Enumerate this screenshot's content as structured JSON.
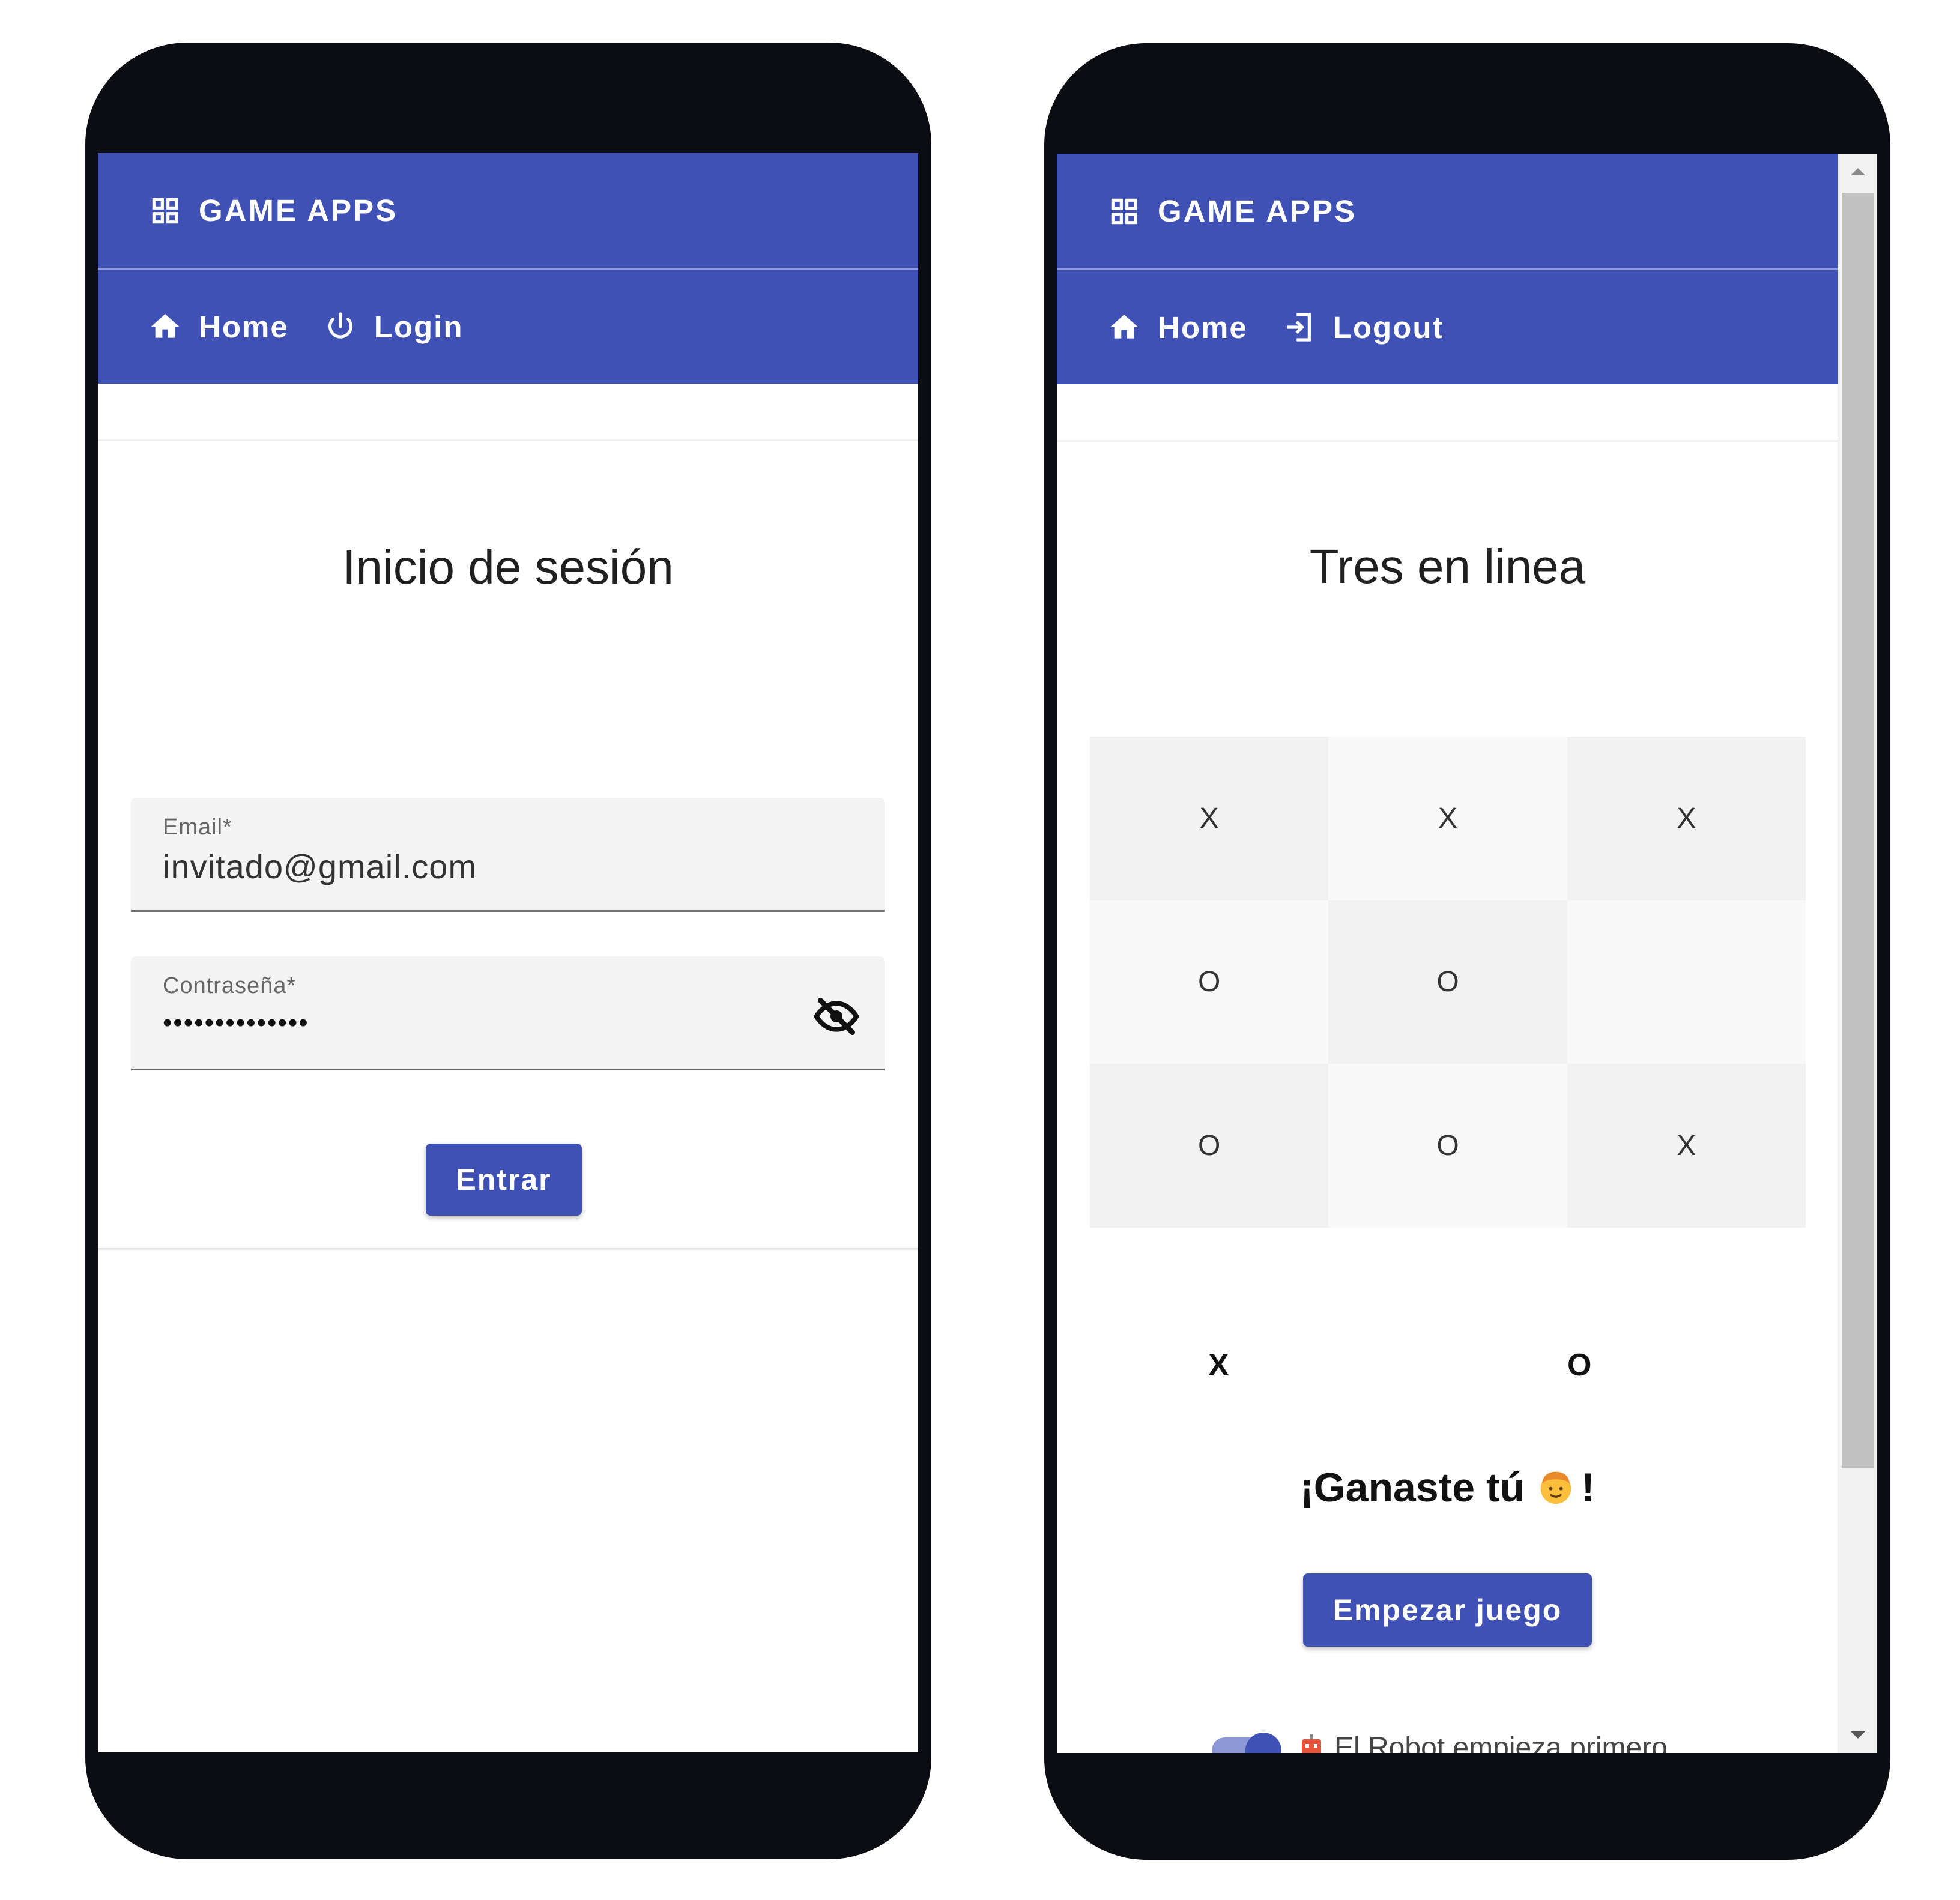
{
  "left_screen": {
    "app_bar": {
      "title": "GAME APPS",
      "icon": "grid-icon"
    },
    "nav": [
      {
        "label": "Home",
        "icon": "home-icon"
      },
      {
        "label": "Login",
        "icon": "power-icon"
      }
    ],
    "login": {
      "title": "Inicio de sesión",
      "email": {
        "label": "Email*",
        "value": "invitado@gmail.com"
      },
      "password": {
        "label": "Contraseña*",
        "value": "••••••••••••••",
        "toggle_icon": "eye-off-icon"
      },
      "submit_label": "Entrar"
    }
  },
  "right_screen": {
    "app_bar": {
      "title": "GAME APPS",
      "icon": "grid-icon"
    },
    "nav": [
      {
        "label": "Home",
        "icon": "home-icon"
      },
      {
        "label": "Logout",
        "icon": "logout-icon"
      }
    ],
    "game": {
      "title": "Tres en linea",
      "board": [
        [
          "X",
          "X",
          "X"
        ],
        [
          "O",
          "O",
          ""
        ],
        [
          "O",
          "O",
          "X"
        ]
      ],
      "players": {
        "x": "X",
        "o": "O"
      },
      "result_prefix": "¡Ganaste tú",
      "result_suffix": "!",
      "result_emoji": "child-face-emoji",
      "start_button": "Empezar juego",
      "robot_toggle": {
        "label": "El Robot empieza primero",
        "icon": "robot-icon",
        "checked": true
      }
    }
  },
  "colors": {
    "primary": "#4051b5",
    "frame": "#0b0d12",
    "field_bg": "#f4f4f4",
    "cell_dark": "#f2f2f2",
    "cell_light": "#f9f9f9"
  }
}
